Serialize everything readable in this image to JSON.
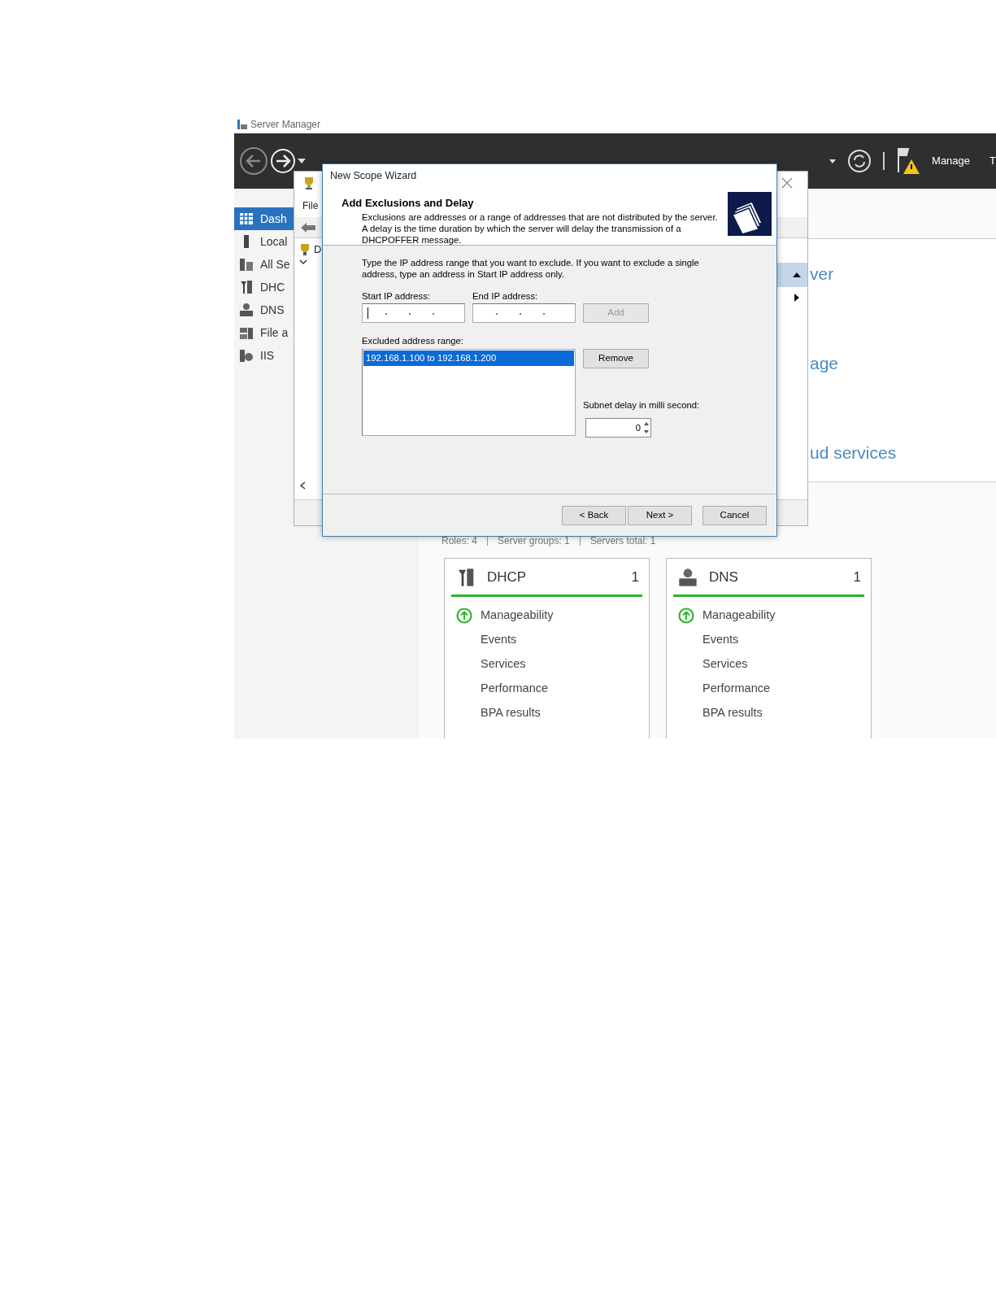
{
  "app_title": "Server Manager",
  "header": {
    "menu": [
      "Manage",
      "T"
    ]
  },
  "sidebar": {
    "items": [
      {
        "label": "Dash",
        "kind": "dashboard",
        "selected": true
      },
      {
        "label": "Local",
        "kind": "local",
        "selected": false
      },
      {
        "label": "All Se",
        "kind": "servers",
        "selected": false
      },
      {
        "label": "DHC",
        "kind": "dhcp",
        "selected": false
      },
      {
        "label": "DNS",
        "kind": "dns",
        "selected": false
      },
      {
        "label": "File a",
        "kind": "files",
        "selected": false
      },
      {
        "label": "IIS",
        "kind": "iis",
        "selected": false
      }
    ]
  },
  "welcome": {
    "links": [
      "ver",
      "age",
      "ud services"
    ]
  },
  "summary": [
    "Roles: 4",
    "Server groups: 1",
    "Servers total: 1"
  ],
  "tiles": [
    {
      "title": "DHCP",
      "kind": "dhcp",
      "count": "1",
      "items": [
        {
          "label": "Manageability",
          "healthy": true
        },
        {
          "label": "Events",
          "healthy": false
        },
        {
          "label": "Services",
          "healthy": false
        },
        {
          "label": "Performance",
          "healthy": false
        },
        {
          "label": "BPA results",
          "healthy": false
        }
      ]
    },
    {
      "title": "DNS",
      "kind": "dns",
      "count": "1",
      "items": [
        {
          "label": "Manageability",
          "healthy": true
        },
        {
          "label": "Events",
          "healthy": false
        },
        {
          "label": "Services",
          "healthy": false
        },
        {
          "label": "Performance",
          "healthy": false
        },
        {
          "label": "BPA results",
          "healthy": false
        }
      ]
    }
  ],
  "dhcp_window": {
    "menu": [
      "File"
    ],
    "tree": [
      "D"
    ]
  },
  "wizard": {
    "title": "New Scope Wizard",
    "heading": "Add Exclusions and Delay",
    "description": "Exclusions are addresses or a range of addresses that are not distributed by the server. A delay is the time duration by which the server will delay the transmission of a DHCPOFFER message.",
    "instruction": "Type the IP address range that you want to exclude. If you want to exclude a single address, type an address in Start IP address only.",
    "start_label": "Start IP address:",
    "start_focused": true,
    "end_label": "End IP address:",
    "end_focused": false,
    "add_button": {
      "label": "Add",
      "disabled": true
    },
    "excluded_label": "Excluded address range:",
    "excluded": [
      {
        "text": "192.168.1.100 to 192.168.1.200",
        "selected": true
      }
    ],
    "remove_button": {
      "label": "Remove",
      "disabled": false
    },
    "delay_label": "Subnet delay in milli second:",
    "delay_value": "0",
    "buttons": [
      {
        "label": "< Back"
      },
      {
        "label": "Next >"
      },
      {
        "label": "Cancel"
      }
    ]
  }
}
